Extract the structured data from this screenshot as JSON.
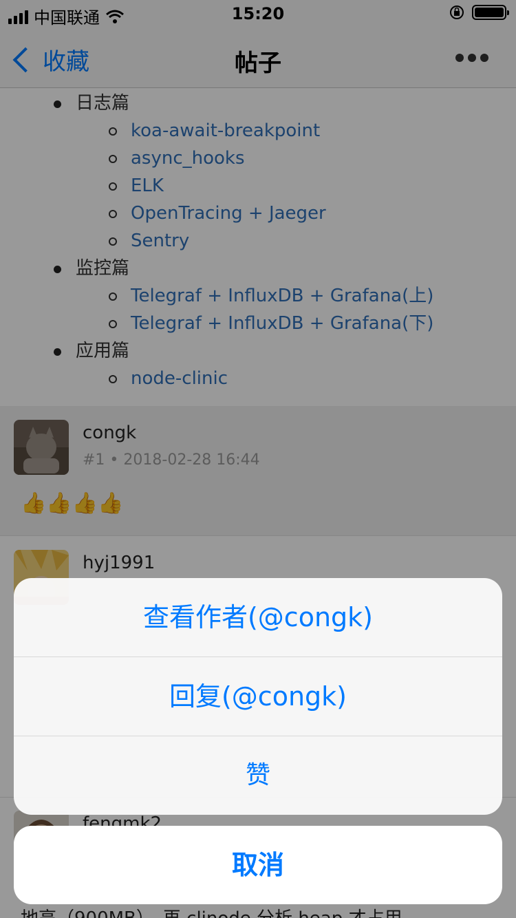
{
  "status_bar": {
    "carrier": "中国联通",
    "time": "15:20"
  },
  "nav": {
    "back_label": "收藏",
    "title": "帖子"
  },
  "toc": [
    {
      "type": "cat",
      "text": "日志篇"
    },
    {
      "type": "sub",
      "text": "koa-await-breakpoint"
    },
    {
      "type": "sub",
      "text": "async_hooks"
    },
    {
      "type": "sub",
      "text": "ELK"
    },
    {
      "type": "sub",
      "text": "OpenTracing + Jaeger"
    },
    {
      "type": "sub",
      "text": "Sentry"
    },
    {
      "type": "cat",
      "text": "监控篇"
    },
    {
      "type": "sub",
      "text": "Telegraf + InfluxDB + Grafana(上)"
    },
    {
      "type": "sub",
      "text": "Telegraf + InfluxDB + Grafana(下)"
    },
    {
      "type": "cat",
      "text": "应用篇"
    },
    {
      "type": "sub",
      "text": "node-clinic"
    }
  ],
  "replies": [
    {
      "name": "congk",
      "meta": "#1 • 2018-02-28 16:44",
      "body": "👍👍👍👍"
    },
    {
      "name": "hyj1991"
    },
    {
      "name": "fengmk2"
    }
  ],
  "tail_text": "地高（900MB），再 clinode 分析 heap 才占用",
  "action_sheet": {
    "items": [
      "查看作者(@congk)",
      "回复(@congk)",
      "赞"
    ],
    "cancel": "取消"
  },
  "colors": {
    "accent": "#007aff",
    "link": "#2f6fb7"
  }
}
